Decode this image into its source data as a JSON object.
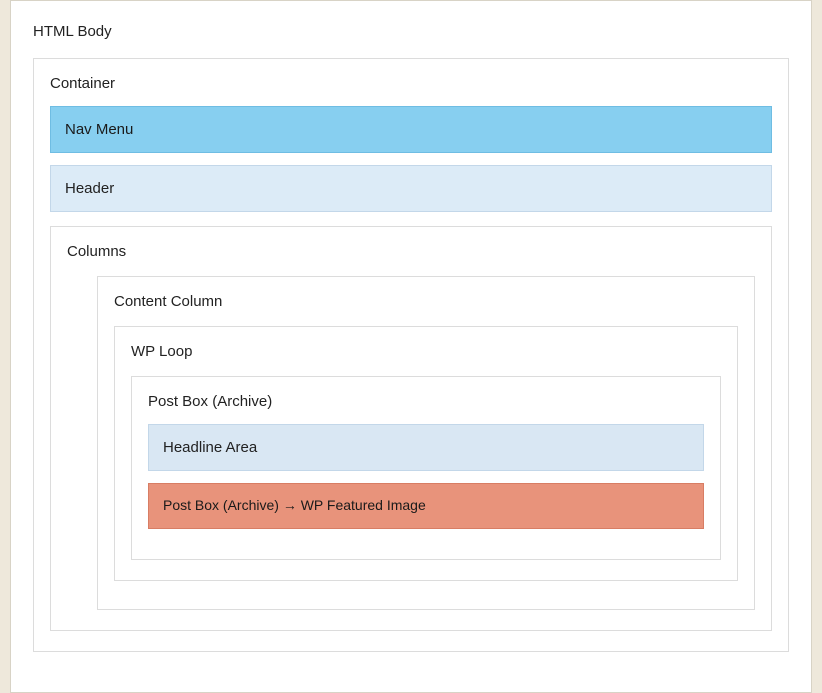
{
  "html_body": {
    "label": "HTML Body"
  },
  "container": {
    "label": "Container"
  },
  "nav_menu": {
    "label": "Nav Menu"
  },
  "header": {
    "label": "Header"
  },
  "columns": {
    "label": "Columns"
  },
  "content_column": {
    "label": "Content Column"
  },
  "wp_loop": {
    "label": "WP Loop"
  },
  "post_box": {
    "label": "Post Box (Archive)"
  },
  "headline_area": {
    "label": "Headline Area"
  },
  "featured_image": {
    "label": "Post Box (Archive) → WP Featured Image"
  }
}
